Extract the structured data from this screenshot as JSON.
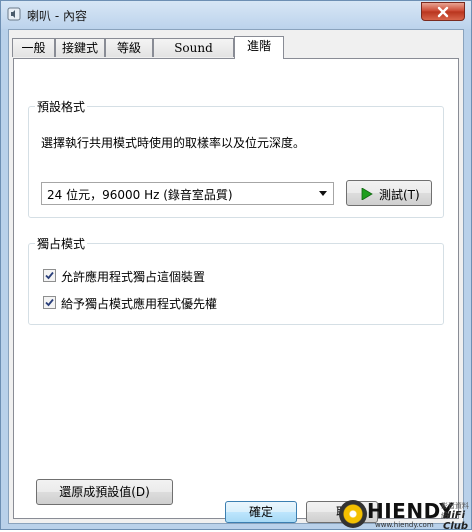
{
  "window": {
    "title": "喇叭 - 內容"
  },
  "tabs": [
    {
      "label": "一般"
    },
    {
      "label": "接鍵式"
    },
    {
      "label": "等級"
    },
    {
      "label": "Sound Blaster"
    },
    {
      "label": "進階"
    }
  ],
  "default_format": {
    "group_label": "預設格式",
    "description": "選擇執行共用模式時使用的取樣率以及位元深度。",
    "selected_format": "24 位元，96000 Hz (錄音室品質)",
    "test_button": "測試(T)"
  },
  "exclusive_mode": {
    "group_label": "獨占模式",
    "options": [
      {
        "label": "允許應用程式獨占這個裝置",
        "checked": true
      },
      {
        "label": "給予獨占模式應用程式優先權",
        "checked": true
      }
    ]
  },
  "restore_button": "還原成預設值(D)",
  "footer": {
    "ok_button": "確定",
    "cancel_button": "取"
  },
  "watermark": {
    "brand": "HIENDY",
    "sub_text": "影音資料網",
    "club_text": "HiFi Club",
    "url": "www.hiendy.com"
  },
  "icons": {
    "window_icon": "speaker-icon",
    "close": "close-icon",
    "dropdown": "chevron-down-icon",
    "play": "play-icon",
    "check": "checkmark-icon"
  },
  "colors": {
    "play_green": "#1e9e1e",
    "close_red": "#c9432d",
    "ok_accent": "#3c7fb1"
  }
}
